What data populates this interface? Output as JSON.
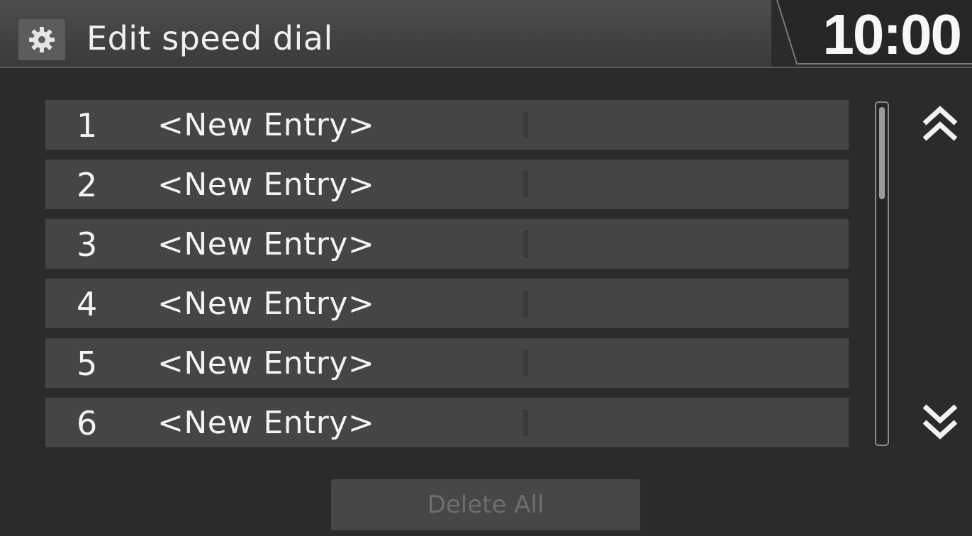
{
  "header": {
    "title": "Edit speed dial",
    "clock": "10:00",
    "settings_icon": "gear-icon"
  },
  "entries": [
    {
      "number": "1",
      "label": "<New Entry>"
    },
    {
      "number": "2",
      "label": "<New Entry>"
    },
    {
      "number": "3",
      "label": "<New Entry>"
    },
    {
      "number": "4",
      "label": "<New Entry>"
    },
    {
      "number": "5",
      "label": "<New Entry>"
    },
    {
      "number": "6",
      "label": "<New Entry>"
    }
  ],
  "scroll": {
    "up_icon": "double-chevron-up-icon",
    "down_icon": "double-chevron-down-icon"
  },
  "footer": {
    "delete_all_label": "Delete All"
  },
  "colors": {
    "background": "#2b2b2b",
    "row": "#454545",
    "header": "#444444",
    "text": "#f2f2f2",
    "disabled_text": "#6e6e6e"
  }
}
